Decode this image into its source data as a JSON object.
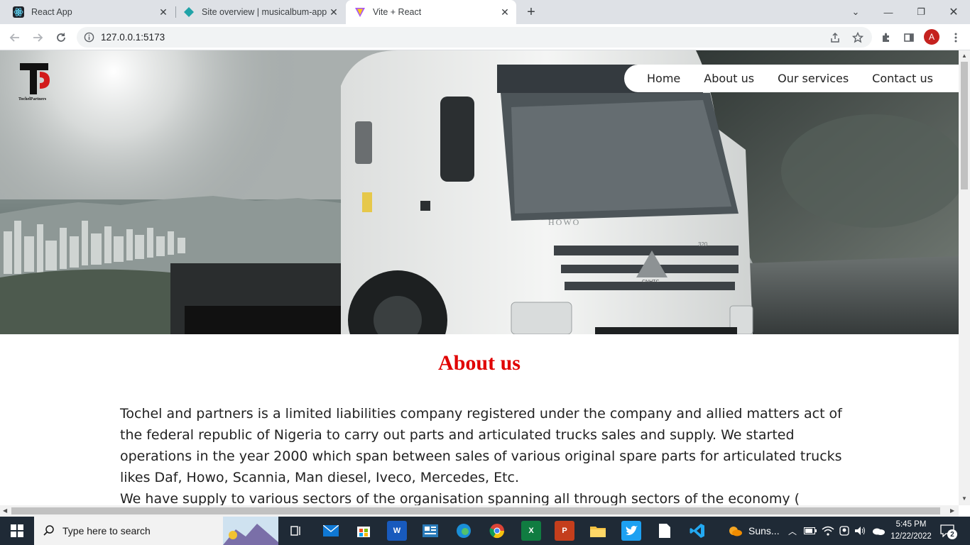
{
  "browser": {
    "tabs": [
      {
        "title": "React App",
        "icon": "react-icon"
      },
      {
        "title": "Site overview | musicalbum-app",
        "icon": "netlify-icon"
      },
      {
        "title": "Vite + React",
        "icon": "vite-icon",
        "active": true
      }
    ],
    "url": "127.0.0.1:5173",
    "profile_initial": "A"
  },
  "page": {
    "logo_text": "TochelPartners",
    "nav": [
      "Home",
      "About us",
      "Our services",
      "Contact us"
    ],
    "about_title": "About us",
    "about_paragraphs": [
      "Tochel and partners is a limited liabilities company registered under the company and allied matters act of the federal republic of Nigeria to carry out parts and articulated trucks sales and supply. We started operations in the year 2000 which span between sales of various original spare parts for articulated trucks likes Daf, Howo, Scannia, Man diesel, Iveco, Mercedes, Etc.",
      "We have supply to various sectors of the organisation spanning all through sectors of the economy ("
    ],
    "hero_truck_text": [
      "HOWO",
      "320",
      "CNHTC"
    ]
  },
  "taskbar": {
    "search_placeholder": "Type here to search",
    "weather_text": "Suns...",
    "time": "5:45 PM",
    "date": "12/22/2022",
    "notification_count": "2"
  },
  "colors": {
    "title_red": "#e00000",
    "taskbar": "#1f2a36",
    "tabstrip": "#dee1e6"
  }
}
